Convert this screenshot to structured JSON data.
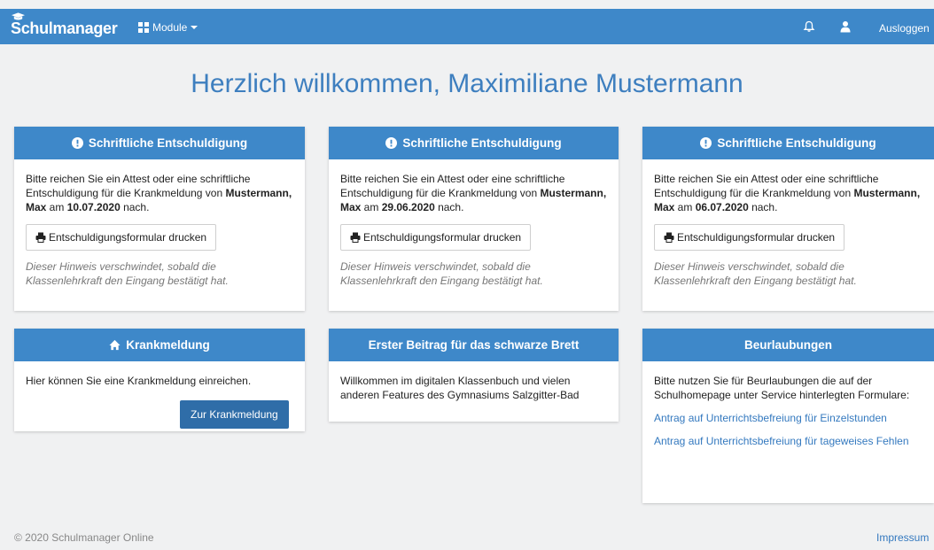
{
  "navbar": {
    "brand": "Schulmanager",
    "module_label": "Module",
    "logout_label": "Ausloggen",
    "icons": [
      "graduation-cap-icon",
      "grid-icon",
      "bell-icon",
      "user-icon"
    ]
  },
  "welcome": {
    "title": "Herzlich willkommen, Maximiliane Mustermann"
  },
  "absence_cards": [
    {
      "header": "Schriftliche Entschuldigung",
      "text_before": "Bitte reichen Sie ein Attest oder eine schriftliche Entschuldigung für die Krankmeldung von ",
      "student": "Mustermann, Max",
      "text_mid": " am ",
      "date": "10.07.2020",
      "text_after": " nach.",
      "button": "Entschuldigungsformular drucken",
      "hint": "Dieser Hinweis verschwindet, sobald die Klassenlehrkraft den Eingang bestätigt hat."
    },
    {
      "header": "Schriftliche Entschuldigung",
      "text_before": "Bitte reichen Sie ein Attest oder eine schriftliche Entschuldigung für die Krankmeldung von ",
      "student": "Mustermann, Max",
      "text_mid": " am ",
      "date": "29.06.2020",
      "text_after": " nach.",
      "button": "Entschuldigungsformular drucken",
      "hint": "Dieser Hinweis verschwindet, sobald die Klassenlehrkraft den Eingang bestätigt hat."
    },
    {
      "header": "Schriftliche Entschuldigung",
      "text_before": "Bitte reichen Sie ein Attest oder eine schriftliche Entschuldigung für die Krankmeldung von ",
      "student": "Mustermann, Max",
      "text_mid": " am ",
      "date": "06.07.2020",
      "text_after": " nach.",
      "button": "Entschuldigungsformular drucken",
      "hint": "Dieser Hinweis verschwindet, sobald die Klassenlehrkraft den Eingang bestätigt hat."
    }
  ],
  "sick_note": {
    "header": "Krankmeldung",
    "text": "Hier können Sie eine Krankmeldung einreichen.",
    "button": "Zur Krankmeldung"
  },
  "board_post": {
    "header": "Erster Beitrag für das schwarze Brett",
    "text": "Willkommen im digitalen Klassenbuch und vielen anderen Features  des Gymnasiums Salzgitter-Bad"
  },
  "leave": {
    "header": "Beurlaubungen",
    "text": "Bitte nutzen Sie für Beurlaubungen die auf der Schulhomepage unter Service hinterlegten Formulare:",
    "link_single_hours": "Antrag auf Unterrichtsbefreiung für Einzelstunden",
    "link_days": "Antrag auf Unterrichtsbefreiung für tageweises Fehlen"
  },
  "footer": {
    "copyright": "© 2020 Schulmanager Online",
    "imprint": "Impressum"
  },
  "colors": {
    "primary": "#3e88c9",
    "primary_dark": "#2f6da8",
    "title": "#3e7fbf",
    "link": "#3479bf",
    "background": "#f0f1f2"
  }
}
